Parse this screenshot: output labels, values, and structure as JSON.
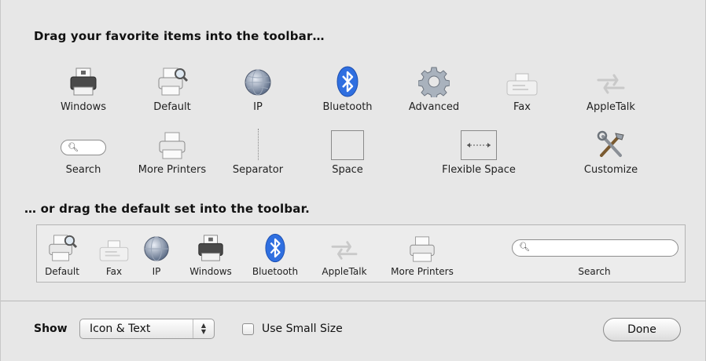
{
  "palette": {
    "heading_top": "Drag your favorite items into the toolbar…",
    "row1": [
      {
        "label": "Windows",
        "icon": "printer-icon"
      },
      {
        "label": "Default",
        "icon": "printer-search-icon"
      },
      {
        "label": "IP",
        "icon": "globe-icon"
      },
      {
        "label": "Bluetooth",
        "icon": "bluetooth-icon"
      },
      {
        "label": "Advanced",
        "icon": "gear-icon"
      },
      {
        "label": "Fax",
        "icon": "fax-icon"
      },
      {
        "label": "AppleTalk",
        "icon": "appletalk-arrows-icon"
      }
    ],
    "row2": [
      {
        "label": "Search",
        "icon": "search-field-icon"
      },
      {
        "label": "More Printers",
        "icon": "printer-icon"
      },
      {
        "label": "Separator",
        "icon": "separator-icon"
      },
      {
        "label": "Space",
        "icon": "space-icon"
      },
      {
        "label": "Flexible Space",
        "icon": "flexible-space-icon"
      },
      {
        "label": "Customize",
        "icon": "tools-icon"
      }
    ],
    "heading_default": "… or drag the default set into the toolbar."
  },
  "default_set": [
    {
      "label": "Default",
      "icon": "printer-search-icon"
    },
    {
      "label": "Fax",
      "icon": "fax-icon"
    },
    {
      "label": "IP",
      "icon": "globe-icon"
    },
    {
      "label": "Windows",
      "icon": "printer-icon"
    },
    {
      "label": "Bluetooth",
      "icon": "bluetooth-icon"
    },
    {
      "label": "AppleTalk",
      "icon": "appletalk-arrows-icon"
    },
    {
      "label": "More Printers",
      "icon": "printer-icon"
    },
    {
      "label": "Search",
      "icon": "search-field-icon"
    }
  ],
  "footer": {
    "show_label": "Show",
    "show_value": "Icon & Text",
    "small_size_label": "Use Small Size",
    "small_size_checked": false,
    "done_label": "Done"
  },
  "colors": {
    "bluetooth_blue": "#2f6fe0",
    "window_bg": "#e7e7e7"
  }
}
